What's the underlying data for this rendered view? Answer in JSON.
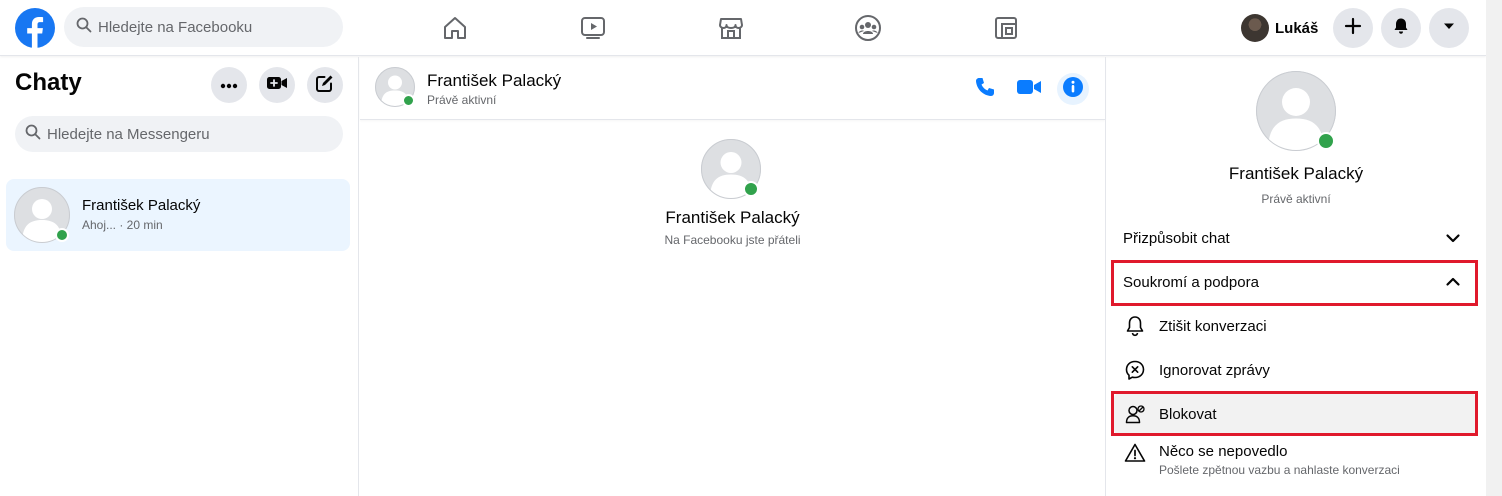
{
  "topbar": {
    "search_placeholder": "Hledejte na Facebooku",
    "user_name": "Lukáš",
    "nav_icons": [
      "home-icon",
      "watch-icon",
      "marketplace-icon",
      "groups-icon",
      "gaming-icon"
    ],
    "brand_color": "#1877f2"
  },
  "left": {
    "title": "Chaty",
    "search_placeholder": "Hledejte na Messengeru",
    "chats": [
      {
        "name": "František Palacký",
        "preview": "Ahoj... · 20 min",
        "online": true
      }
    ]
  },
  "conversation": {
    "name": "František Palacký",
    "status": "Právě aktivní",
    "intro_name": "František Palacký",
    "intro_subtitle": "Na Facebooku jste přáteli"
  },
  "details": {
    "name": "František Palacký",
    "status": "Právě aktivní",
    "sections": {
      "customize": "Přizpůsobit chat",
      "privacy": "Soukromí a podpora"
    },
    "options": {
      "mute": "Ztišit konverzaci",
      "ignore": "Ignorovat zprávy",
      "block": "Blokovat",
      "report_title": "Něco se nepovedlo",
      "report_subtitle": "Pošlete zpětnou vazbu a nahlaste konverzaci"
    },
    "highlight_color": "#e0192c"
  }
}
